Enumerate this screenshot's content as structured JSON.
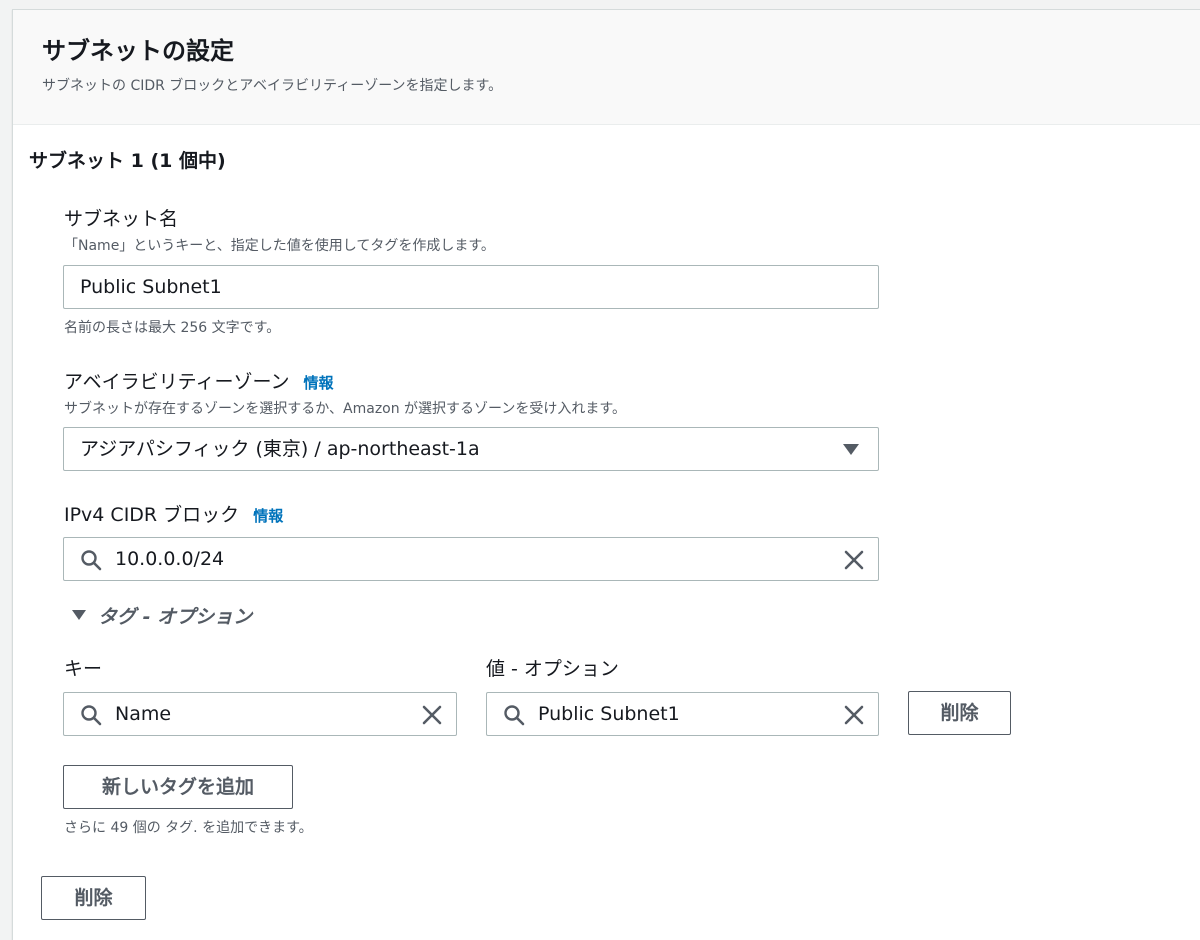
{
  "panel": {
    "title": "サブネットの設定",
    "description": "サブネットの CIDR ブロックとアベイラビリティーゾーンを指定します。"
  },
  "subnet": {
    "heading": "サブネット 1 (1 個中)",
    "name_field": {
      "label": "サブネット名",
      "description": "「Name」というキーと、指定した値を使用してタグを作成します。",
      "value": "Public Subnet1",
      "constraint": "名前の長さは最大 256 文字です。"
    },
    "az_field": {
      "label": "アベイラビリティーゾーン",
      "info": "情報",
      "description": "サブネットが存在するゾーンを選択するか、Amazon が選択するゾーンを受け入れます。",
      "selected": "アジアパシフィック (東京) / ap-northeast-1a"
    },
    "cidr_field": {
      "label": "IPv4 CIDR ブロック",
      "info": "情報",
      "value": "10.0.0.0/24"
    },
    "tags": {
      "toggle_label": "タグ - オプション",
      "key_header": "キー",
      "value_header": "値 - オプション",
      "rows": [
        {
          "key": "Name",
          "value": "Public Subnet1",
          "remove_label": "削除"
        }
      ],
      "add_label": "新しいタグを追加",
      "remaining": "さらに 49 個の タグ. を追加できます。"
    },
    "remove_subnet_label": "削除"
  },
  "icons": {
    "search": "search-icon",
    "clear": "close-icon",
    "dropdown": "caret-down-icon",
    "expand": "caret-down-icon"
  },
  "colors": {
    "link": "#0073bb",
    "border": "#aab7b8",
    "text": "#16191f",
    "secondary_text": "#545b64"
  }
}
